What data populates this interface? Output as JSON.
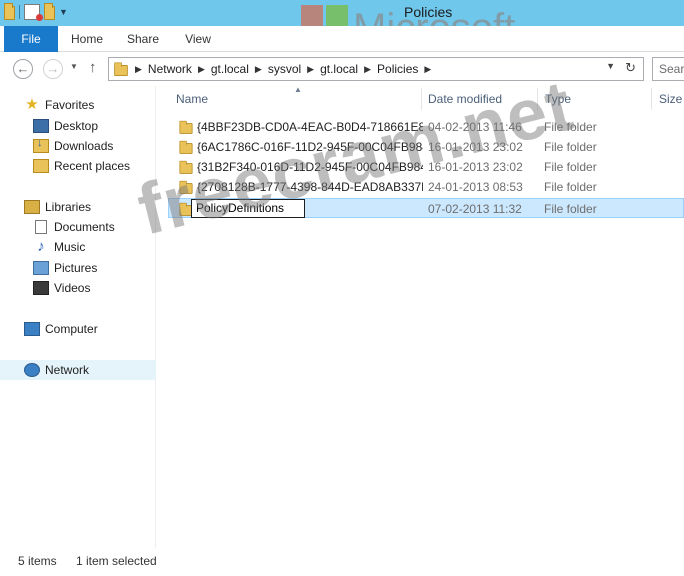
{
  "window": {
    "title": "Policies"
  },
  "watermark": {
    "logo_word": "Microsoft",
    "site": "freecram.net"
  },
  "ribbon": {
    "tabs": [
      {
        "label": "File"
      },
      {
        "label": "Home"
      },
      {
        "label": "Share"
      },
      {
        "label": "View"
      }
    ]
  },
  "address": {
    "crumbs": [
      "Network",
      "gt.local",
      "sysvol",
      "gt.local",
      "Policies"
    ]
  },
  "search": {
    "placeholder": "Sear"
  },
  "nav_pane": {
    "favorites": {
      "label": "Favorites",
      "items": [
        {
          "label": "Desktop"
        },
        {
          "label": "Downloads"
        },
        {
          "label": "Recent places"
        }
      ]
    },
    "libraries": {
      "label": "Libraries",
      "items": [
        {
          "label": "Documents"
        },
        {
          "label": "Music"
        },
        {
          "label": "Pictures"
        },
        {
          "label": "Videos"
        }
      ]
    },
    "computer": {
      "label": "Computer"
    },
    "network": {
      "label": "Network"
    }
  },
  "file_list": {
    "columns": {
      "name": "Name",
      "date": "Date modified",
      "type": "Type",
      "size": "Size"
    },
    "rows": [
      {
        "name": "{4BBF23DB-CD0A-4EAC-B0D4-718661E88...",
        "date": "04-02-2013 11:46",
        "type": "File folder"
      },
      {
        "name": "{6AC1786C-016F-11D2-945F-00C04FB984...",
        "date": "16-01-2013 23:02",
        "type": "File folder"
      },
      {
        "name": "{31B2F340-016D-11D2-945F-00C04FB984...",
        "date": "16-01-2013 23:02",
        "type": "File folder"
      },
      {
        "name": "{2708128B-1777-4398-844D-EAD8AB337D...",
        "date": "24-01-2013 08:53",
        "type": "File folder"
      },
      {
        "name": "PolicyDefinitions",
        "date": "07-02-2013 11:32",
        "type": "File folder"
      }
    ]
  },
  "status": {
    "item_count": "5 items",
    "selection": "1 item selected"
  },
  "colors": {
    "title_bar": "#6fc7ec",
    "file_tab": "#1979ca",
    "selection": "#cce8ff"
  }
}
